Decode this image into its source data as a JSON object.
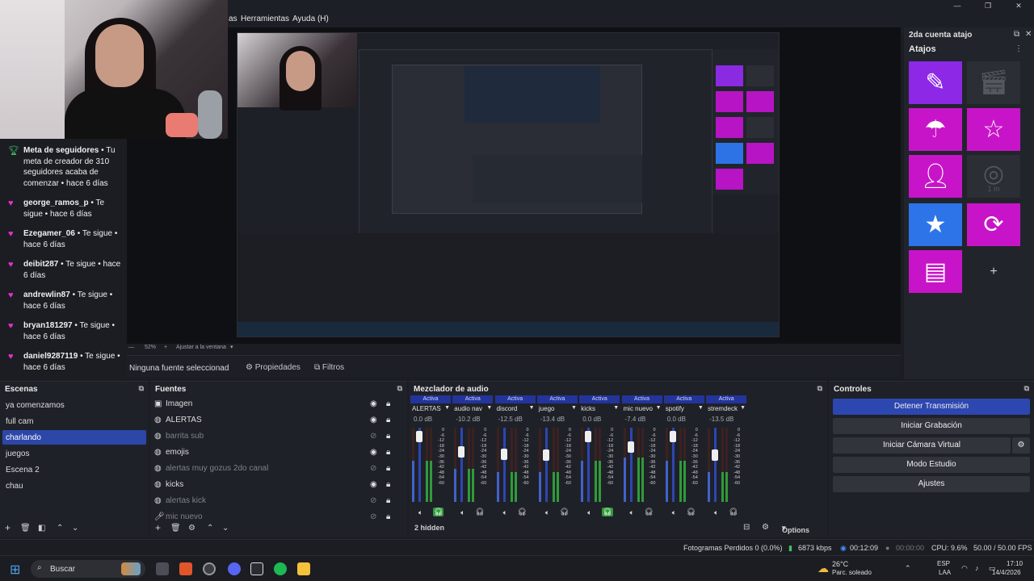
{
  "menu": {
    "items": [
      "as",
      "Herramientas",
      "Ayuda (H)"
    ]
  },
  "window_controls": [
    "—",
    "❐",
    "✕"
  ],
  "chat": [
    {
      "icon": "trophy-icon",
      "user": "Meta de seguidores",
      "text": "• Tu meta de creador de 310 seguidores acaba de comenzar • hace 6 días"
    },
    {
      "icon": "heart-icon",
      "user": "george_ramos_p",
      "text": "• Te sigue • hace 6 días"
    },
    {
      "icon": "heart-icon",
      "user": "Ezegamer_06",
      "text": "• Te sigue • hace 6 días"
    },
    {
      "icon": "heart-icon",
      "user": "deibit287",
      "text": "• Te sigue • hace 6 días"
    },
    {
      "icon": "heart-icon",
      "user": "andrewlin87",
      "text": "• Te sigue • hace 6 días"
    },
    {
      "icon": "heart-icon",
      "user": "bryan181297",
      "text": "• Te sigue • hace 6 días"
    },
    {
      "icon": "heart-icon",
      "user": "daniel9287119",
      "text": "• Te sigue • hace 6 días"
    }
  ],
  "atajos_dock": {
    "title": "2da cuenta atajo",
    "subtitle": "Atajos",
    "tiles": [
      {
        "icon": "pencil-icon",
        "color": "purple",
        "glyph": "✎"
      },
      {
        "icon": "clapperboard-icon",
        "color": "dark",
        "glyph": "🎬︎"
      },
      {
        "icon": "parachute-icon",
        "color": "magenta",
        "glyph": "☂"
      },
      {
        "icon": "star-outline-icon",
        "color": "magenta",
        "glyph": "☆"
      },
      {
        "icon": "add-user-icon",
        "color": "magenta",
        "glyph": "👤︎"
      },
      {
        "icon": "camera-timer-icon",
        "color": "dark",
        "glyph": "◎",
        "label": "1 m"
      },
      {
        "icon": "star-filled-icon",
        "color": "blue",
        "glyph": "★"
      },
      {
        "icon": "timer-refresh-icon",
        "color": "magenta",
        "glyph": "⟳"
      },
      {
        "icon": "layout-icon",
        "color": "magenta",
        "glyph": "▤"
      },
      {
        "icon": "plus-icon",
        "color": "none",
        "glyph": "+"
      }
    ]
  },
  "zoom": {
    "percent": "52%",
    "fit_label": "Ajustar a la ventana"
  },
  "source_bar": {
    "none_selected": "Ninguna fuente seleccionad",
    "properties": "Propiedades",
    "filters": "Filtros"
  },
  "scenes": {
    "title": "Escenas",
    "items": [
      "ya comenzamos",
      "full cam",
      "charlando",
      "juegos",
      "Escena 2",
      "chau"
    ],
    "selected": "charlando"
  },
  "sources": {
    "title": "Fuentes",
    "items": [
      {
        "name": "Imagen",
        "icon": "image-icon",
        "visible": true
      },
      {
        "name": "ALERTAS",
        "icon": "browser-icon",
        "visible": true
      },
      {
        "name": "barrita sub",
        "icon": "browser-icon",
        "visible": false
      },
      {
        "name": "emojis",
        "icon": "browser-icon",
        "visible": true
      },
      {
        "name": "alertas muy gozus 2do canal",
        "icon": "browser-icon",
        "visible": false
      },
      {
        "name": "kicks",
        "icon": "browser-icon",
        "visible": true
      },
      {
        "name": "alertas kick",
        "icon": "browser-icon",
        "visible": false
      },
      {
        "name": "mic nuevo",
        "icon": "mic-icon",
        "visible": false
      }
    ]
  },
  "mixer": {
    "title": "Mezclador de audio",
    "active_label": "Activa",
    "hidden": "2 hidden",
    "options": "Options",
    "scale": [
      "0",
      "-6",
      "-12",
      "-18",
      "-24",
      "-30",
      "-36",
      "-42",
      "-48",
      "-54",
      "-60"
    ],
    "channels": [
      {
        "name": "ALERTAS",
        "db": "0.0 dB",
        "level": 0.55,
        "knob": 0.05,
        "headphones": true
      },
      {
        "name": "audio nav",
        "db": "-10.2 dB",
        "level": 0.45,
        "knob": 0.3,
        "headphones": false
      },
      {
        "name": "discord",
        "db": "-12.5 dB",
        "level": 0.4,
        "knob": 0.33,
        "headphones": false
      },
      {
        "name": "juego",
        "db": "-13.4 dB",
        "level": 0.4,
        "knob": 0.35,
        "headphones": false
      },
      {
        "name": "kicks",
        "db": "0.0 dB",
        "level": 0.55,
        "knob": 0.05,
        "headphones": true
      },
      {
        "name": "mic nuevo",
        "db": "-7.4 dB",
        "level": 0.6,
        "knob": 0.22,
        "headphones": false
      },
      {
        "name": "spotify",
        "db": "0.0 dB",
        "level": 0.55,
        "knob": 0.05,
        "headphones": false
      },
      {
        "name": "stremdeck",
        "db": "-13.5 dB",
        "level": 0.4,
        "knob": 0.35,
        "headphones": false
      }
    ]
  },
  "controls": {
    "title": "Controles",
    "stop_stream": "Detener Transmisión",
    "start_record": "Iniciar Grabación",
    "virtual_cam": "Iniciar Cámara Virtual",
    "studio_mode": "Modo Estudio",
    "settings": "Ajustes"
  },
  "status": {
    "dropped": "Fotogramas Perdidos 0 (0.0%)",
    "bitrate": "6873 kbps",
    "stream_time": "00:12:09",
    "rec_time": "00:00:00",
    "cpu": "CPU: 9.6%",
    "fps": "50.00 / 50.00 FPS"
  },
  "taskbar": {
    "search": "Buscar",
    "weather_temp": "26°C",
    "weather_desc": "Parc. soleado",
    "lang_top": "ESP",
    "lang_bottom": "LAA",
    "time": "17:10",
    "date": "14/4/2026"
  },
  "colors": {
    "accent": "#2d47b0",
    "magenta": "#c814c8",
    "purple": "#8c28e6",
    "blue": "#2d74e8",
    "green": "#2f9b3a"
  }
}
